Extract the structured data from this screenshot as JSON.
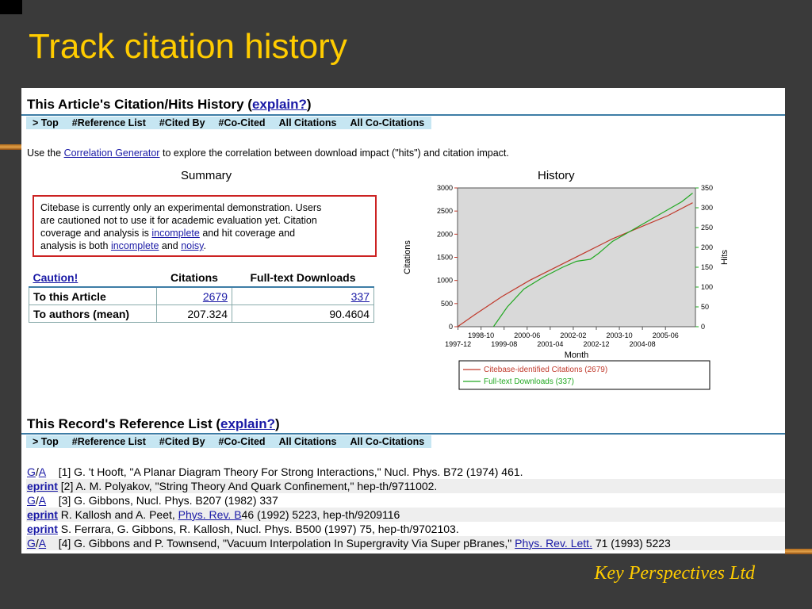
{
  "slide": {
    "title": "Track citation history",
    "footer": "Key Perspectives Ltd"
  },
  "article_section": {
    "title": "This Article's Citation/Hits History (",
    "explain_link": "explain?",
    "close_paren": ")"
  },
  "nav": {
    "items": [
      "> Top",
      "#Reference List",
      "#Cited By",
      "#Co-Cited",
      "All Citations",
      "All Co-Citations"
    ]
  },
  "intro": {
    "prefix": "Use the",
    "link": "Correlation Generator",
    "suffix": "to explore the correlation between download impact (\"hits\") and citation impact."
  },
  "summary": {
    "title": "Summary",
    "warning_line1": "Citebase is currently only an experimental demonstration. Users",
    "warning_line2": "are cautioned not to use it for academic evaluation yet. Citation",
    "warning_line3_pre": "coverage and analysis is",
    "warning_line3_link": "incomplete",
    "warning_line3_post": "and hit coverage and",
    "warning_line4_pre": "analysis is both",
    "warning_line4_link1": "incomplete",
    "warning_line4_mid": "and",
    "warning_line4_link2": "noisy",
    "warning_line4_post": "."
  },
  "stats_table": {
    "headers": [
      "Caution!",
      "Citations",
      "Full-text Downloads"
    ],
    "rows": [
      {
        "label": "To this Article",
        "citations": "2679",
        "downloads": "337"
      },
      {
        "label": "To authors (mean)",
        "citations": "207.324",
        "downloads": "90.4604"
      }
    ]
  },
  "history": {
    "title": "History"
  },
  "chart_data": {
    "type": "line",
    "title": "History",
    "xlabel": "Month",
    "ylabel": "Citations",
    "y2label": "Hits",
    "x_ticks_top": [
      "1998-10",
      "2000-06",
      "2002-02",
      "2003-10",
      "2005-06"
    ],
    "x_ticks_bottom": [
      "1997-12",
      "1999-08",
      "2001-04",
      "2002-12",
      "2004-08"
    ],
    "y_ticks": [
      0,
      500,
      1000,
      1500,
      2000,
      2500,
      3000
    ],
    "y2_ticks": [
      0,
      50,
      100,
      150,
      200,
      250,
      300,
      350
    ],
    "ylim": [
      0,
      3000
    ],
    "y2lim": [
      0,
      350
    ],
    "xlim": [
      1997.9,
      2006.5
    ],
    "grid": false,
    "legend_position": "bottom",
    "series": [
      {
        "name": "Citebase-identified Citations (2679)",
        "axis": "left",
        "color": "#c0392b",
        "x": [
          1997.9,
          1998.5,
          1999.5,
          2000.5,
          2001.5,
          2002.5,
          2003.5,
          2004.5,
          2005.5,
          2006.4
        ],
        "y": [
          0,
          250,
          650,
          1000,
          1300,
          1600,
          1900,
          2150,
          2400,
          2679
        ]
      },
      {
        "name": "Full-text Downloads (337)",
        "axis": "right",
        "color": "#22a822",
        "x": [
          1999.2,
          1999.7,
          2000.3,
          2001.0,
          2001.7,
          2002.2,
          2002.7,
          2003.0,
          2003.5,
          2004.0,
          2004.5,
          2005.0,
          2005.5,
          2006.0,
          2006.4
        ],
        "y": [
          0,
          50,
          95,
          125,
          150,
          165,
          170,
          185,
          215,
          235,
          255,
          275,
          295,
          315,
          337
        ]
      }
    ]
  },
  "reference_section": {
    "title": "This Record's Reference List (",
    "explain_link": "explain?",
    "close_paren": ")"
  },
  "references": [
    {
      "tag1": "G",
      "tag2": "A",
      "kind": "ga",
      "text": "[1] G. 't Hooft, \"A Planar Diagram Theory For Strong Interactions,\" Nucl. Phys. B72 (1974) 461."
    },
    {
      "tag1": "eprint",
      "kind": "eprint",
      "text": "[2] A. M. Polyakov, \"String Theory And Quark Confinement,\" hep-th/9711002."
    },
    {
      "tag1": "G",
      "tag2": "A",
      "kind": "ga",
      "text": "[3] G. Gibbons, Nucl. Phys. B207 (1982) 337"
    },
    {
      "tag1": "eprint",
      "kind": "eprint",
      "text_pre": "R. Kallosh and A. Peet,",
      "link": "Phys. Rev. B",
      "text_post": "46 (1992) 5223, hep-th/9209116"
    },
    {
      "tag1": "eprint",
      "kind": "eprint",
      "text": "S. Ferrara, G. Gibbons, R. Kallosh, Nucl. Phys. B500 (1997) 75, hep-th/9702103."
    },
    {
      "tag1": "G",
      "tag2": "A",
      "kind": "ga",
      "text_pre": "[4] G. Gibbons and P. Townsend, \"Vacuum Interpolation In Supergravity Via Super pBranes,\"",
      "link": "Phys. Rev. Lett.",
      "text_post": "71 (1993) 5223"
    }
  ]
}
